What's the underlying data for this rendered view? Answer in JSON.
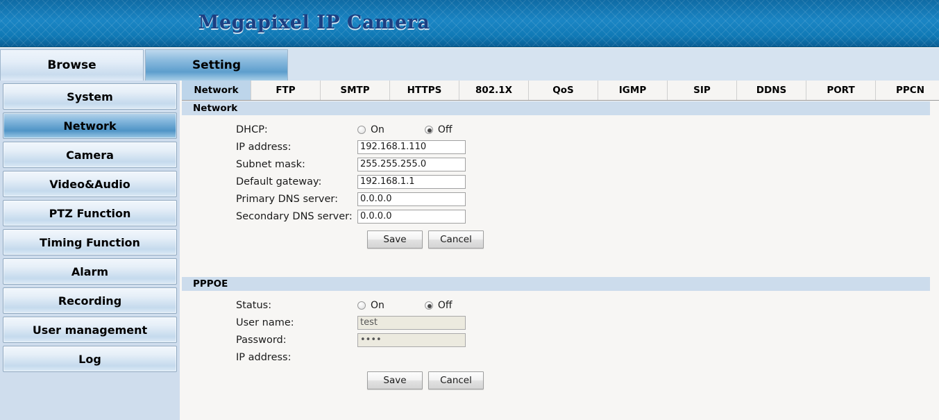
{
  "banner": {
    "title": "Megapixel IP Camera"
  },
  "toptabs": [
    {
      "label": "Browse",
      "active": false
    },
    {
      "label": "Setting",
      "active": true
    }
  ],
  "sidebar": {
    "items": [
      {
        "label": "System",
        "selected": false
      },
      {
        "label": "Network",
        "selected": true
      },
      {
        "label": "Camera",
        "selected": false
      },
      {
        "label": "Video&Audio",
        "selected": false
      },
      {
        "label": "PTZ Function",
        "selected": false
      },
      {
        "label": "Timing Function",
        "selected": false
      },
      {
        "label": "Alarm",
        "selected": false
      },
      {
        "label": "Recording",
        "selected": false
      },
      {
        "label": "User management",
        "selected": false
      },
      {
        "label": "Log",
        "selected": false
      }
    ]
  },
  "subtabs": [
    {
      "label": "Network",
      "active": true
    },
    {
      "label": "FTP",
      "active": false
    },
    {
      "label": "SMTP",
      "active": false
    },
    {
      "label": "HTTPS",
      "active": false
    },
    {
      "label": "802.1X",
      "active": false
    },
    {
      "label": "QoS",
      "active": false
    },
    {
      "label": "IGMP",
      "active": false
    },
    {
      "label": "SIP",
      "active": false
    },
    {
      "label": "DDNS",
      "active": false
    },
    {
      "label": "PORT",
      "active": false
    },
    {
      "label": "PPCN",
      "active": false
    }
  ],
  "network_section": {
    "heading": "Network",
    "dhcp": {
      "label": "DHCP:",
      "on_label": "On",
      "off_label": "Off",
      "selected": "Off"
    },
    "fields": [
      {
        "label": "IP address:",
        "value": "192.168.1.110"
      },
      {
        "label": "Subnet mask:",
        "value": "255.255.255.0"
      },
      {
        "label": "Default gateway:",
        "value": "192.168.1.1"
      },
      {
        "label": "Primary DNS server:",
        "value": "0.0.0.0"
      },
      {
        "label": "Secondary DNS server:",
        "value": "0.0.0.0"
      }
    ],
    "save_label": "Save",
    "cancel_label": "Cancel"
  },
  "pppoe_section": {
    "heading": "PPPOE",
    "status": {
      "label": "Status:",
      "on_label": "On",
      "off_label": "Off",
      "selected": "Off"
    },
    "username": {
      "label": "User name:",
      "value": "test"
    },
    "password": {
      "label": "Password:",
      "value": "••••"
    },
    "ip": {
      "label": "IP address:",
      "value": ""
    },
    "save_label": "Save",
    "cancel_label": "Cancel"
  },
  "colors": {
    "banner_blue": "#1278b3",
    "title_navy": "#1c3f82",
    "sidebar_bg": "#cfdded",
    "selected_blue": "#5d9ecd",
    "section_head": "#ccdcec",
    "content_bg": "#f7f6f4"
  }
}
